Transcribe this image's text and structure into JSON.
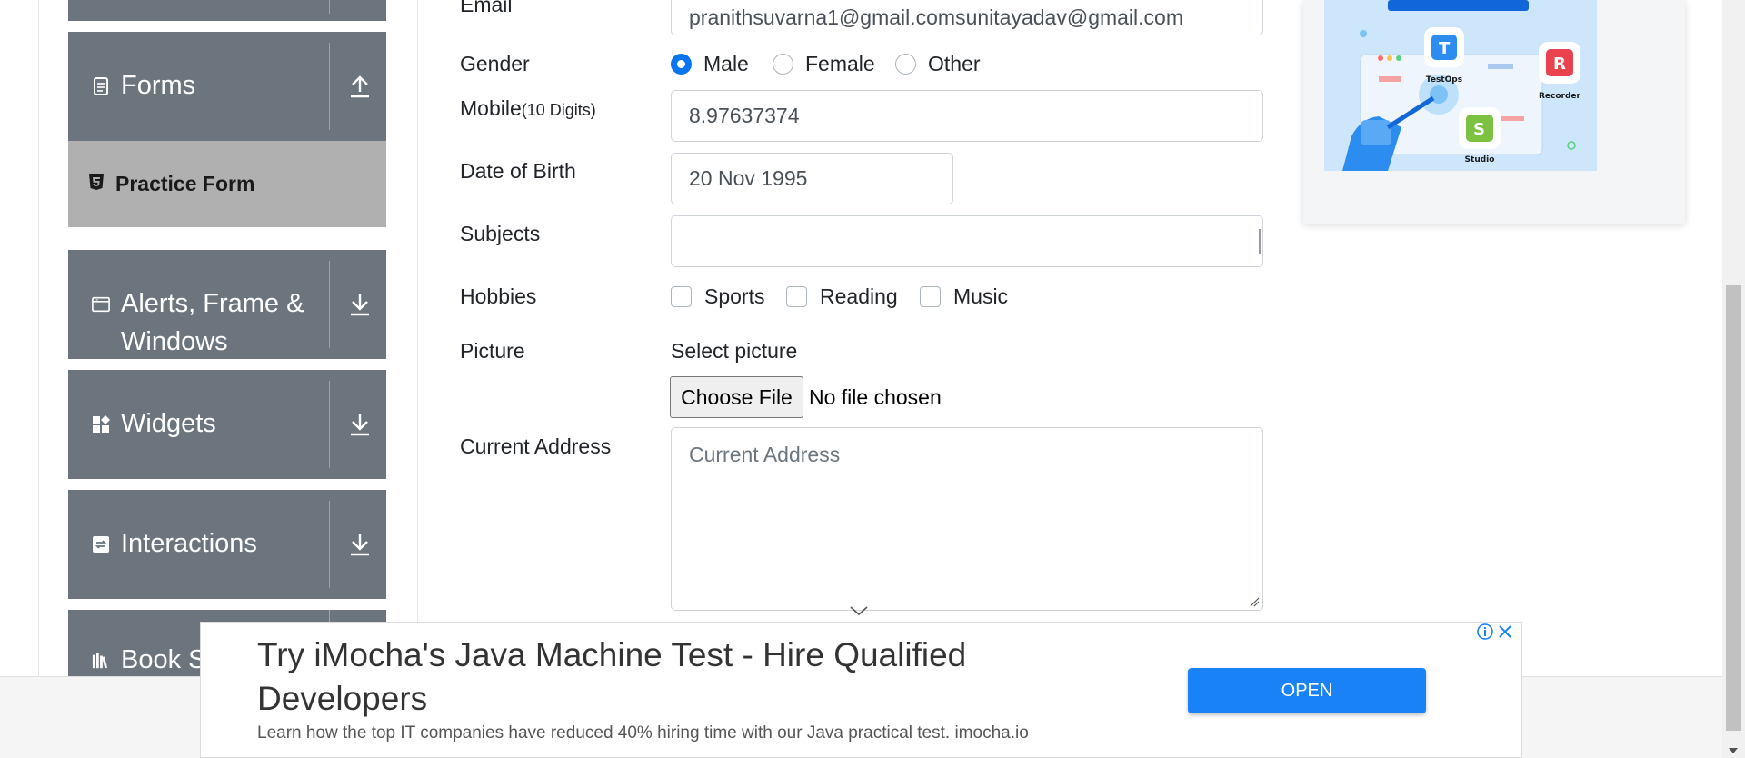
{
  "sidebar": {
    "groups": [
      {
        "key": "forms",
        "label": "Forms",
        "icon": "document-icon",
        "expanded": true
      },
      {
        "key": "alerts",
        "label": "Alerts, Frame & Windows",
        "icon": "window-icon",
        "expanded": false
      },
      {
        "key": "widgets",
        "label": "Widgets",
        "icon": "widgets-icon",
        "expanded": false
      },
      {
        "key": "interactions",
        "label": "Interactions",
        "icon": "interactions-icon",
        "expanded": false
      },
      {
        "key": "book",
        "label": "Book S",
        "icon": "books-icon",
        "expanded": false
      }
    ],
    "active_item": {
      "label": "Practice Form",
      "icon": "html5-icon"
    }
  },
  "form": {
    "email": {
      "label": "Email",
      "value": "pranithsuvarna1@gmail.comsunitayadav@gmail.com"
    },
    "gender": {
      "label": "Gender",
      "options": [
        "Male",
        "Female",
        "Other"
      ],
      "selected": "Male"
    },
    "mobile": {
      "label": "Mobile",
      "hint": "(10 Digits)",
      "value": "8.97637374"
    },
    "dob": {
      "label": "Date of Birth",
      "value": "20 Nov 1995"
    },
    "subjects": {
      "label": "Subjects",
      "value": ""
    },
    "hobbies": {
      "label": "Hobbies",
      "options": [
        "Sports",
        "Reading",
        "Music"
      ],
      "checked": []
    },
    "picture": {
      "label": "Picture",
      "caption": "Select picture",
      "button": "Choose File",
      "status": "No file chosen"
    },
    "address": {
      "label": "Current Address",
      "placeholder": "Current Address"
    }
  },
  "ad_right": {
    "labels": [
      "TestOps",
      "Recorder",
      "Studio"
    ]
  },
  "ad_bottom": {
    "headline": "Try iMocha's Java Machine Test - Hire Qualified Developers",
    "description": "Learn how the top IT companies have reduced 40% hiring time with our Java practical test. imocha.io",
    "button": "OPEN"
  },
  "colors": {
    "sidebar_group_bg": "#6c757d",
    "active_item_bg": "#b0b0b0",
    "radio_accent": "#0a75f0",
    "ad_button": "#1a82f7"
  }
}
